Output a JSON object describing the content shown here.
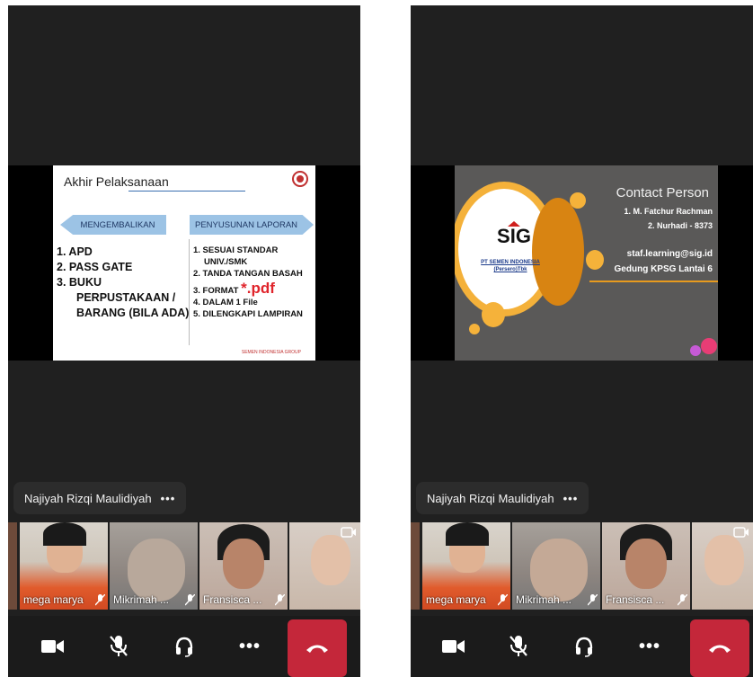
{
  "colors": {
    "accent_end_call": "#c4273a",
    "slide_accent": "#e79a1e",
    "slide_header_blue": "#9cc3e5"
  },
  "left": {
    "slide": {
      "title": "Akhir Pelaksanaan",
      "left_header": "MENGEMBALIKAN",
      "right_header": "PENYUSUNAN LAPORAN",
      "left_items": [
        "1.  APD",
        "2.  PASS GATE",
        "3.  BUKU",
        "PERPUSTAKAAN /",
        "BARANG (BILA ADA)"
      ],
      "right_items": [
        "1. SESUAI STANDAR",
        "UNIV./SMK",
        "2. TANDA TANGAN BASAH",
        "3. FORMAT",
        "*.pdf",
        "4. DALAM 1 File",
        "5. DILENGKAPI LAMPIRAN"
      ],
      "footer": "SEMEN INDONESIA GROUP"
    },
    "speaker": {
      "name": "Najiyah Rizqi Maulidiyah",
      "more": "•••"
    },
    "participants": [
      {
        "name": "mega marya",
        "icon": "mic-off-icon"
      },
      {
        "name": "Mikrimah ...",
        "icon": "mic-off-icon"
      },
      {
        "name": "Fransisca ...",
        "icon": "mic-off-icon"
      }
    ]
  },
  "right": {
    "slide": {
      "title": "Contact Person",
      "contact1": "1. M. Fatchur Rachman",
      "contact2": "2. Nurhadi - 8373",
      "email": "staf.learning@sig.id",
      "building": "Gedung KPSG Lantai 6",
      "logo_text": "SIG",
      "logo_caption1": "PT SEMEN INDONESIA",
      "logo_caption2": "(Persero)Tbk"
    },
    "speaker": {
      "name": "Najiyah Rizqi Maulidiyah",
      "more": "•••"
    },
    "participants": [
      {
        "name": "mega marya",
        "icon": "mic-off-icon"
      },
      {
        "name": "Mikrimah ...",
        "icon": "mic-off-icon"
      },
      {
        "name": "Fransisca ...",
        "icon": "mic-off-icon"
      }
    ]
  },
  "controls": [
    "video-camera-icon",
    "mic-off-icon",
    "headset-icon",
    "more-icon",
    "end-call-icon"
  ],
  "more_label": "•••"
}
